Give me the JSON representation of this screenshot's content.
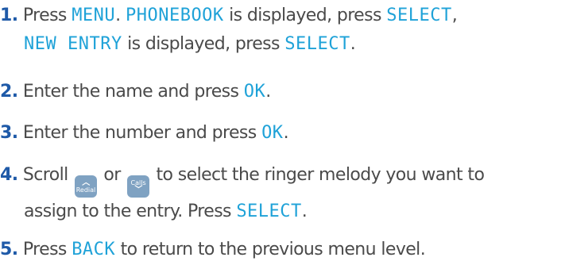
{
  "steps": [
    {
      "num": "1",
      "t1": "Press ",
      "d1": "MENU",
      "t2": ". ",
      "d2": "PHONEBOOK",
      "t3": " is displayed, press ",
      "d3": "SELECT",
      "t4": ",",
      "d4": "NEW ENTRY",
      "t5": " is displayed, press ",
      "d5": "SELECT",
      "t6": "."
    },
    {
      "num": "2",
      "t1": "Enter the name and press ",
      "d1": "OK",
      "t2": "."
    },
    {
      "num": "3",
      "t1": "Enter the number and press ",
      "d1": "OK",
      "t2": "."
    },
    {
      "num": "4",
      "t1": "Scroll ",
      "key_up_label": "Redial",
      "t2": " or ",
      "key_down_label": "Calls",
      "t3": " to select the ringer melody you want to",
      "t4": "assign to the entry. Press ",
      "d1": "SELECT",
      "t5": "."
    },
    {
      "num": "5",
      "t1": "Press ",
      "d1": "BACK",
      "t2": " to return to the previous menu level."
    }
  ],
  "colors": {
    "number": "#1f5aa8",
    "display_text": "#1fa2d8",
    "body_text": "#4a4a4a",
    "key_bg": "#7fa2c2"
  },
  "icons": {
    "up_key": "chevron-up-icon",
    "down_key": "chevron-down-icon"
  }
}
